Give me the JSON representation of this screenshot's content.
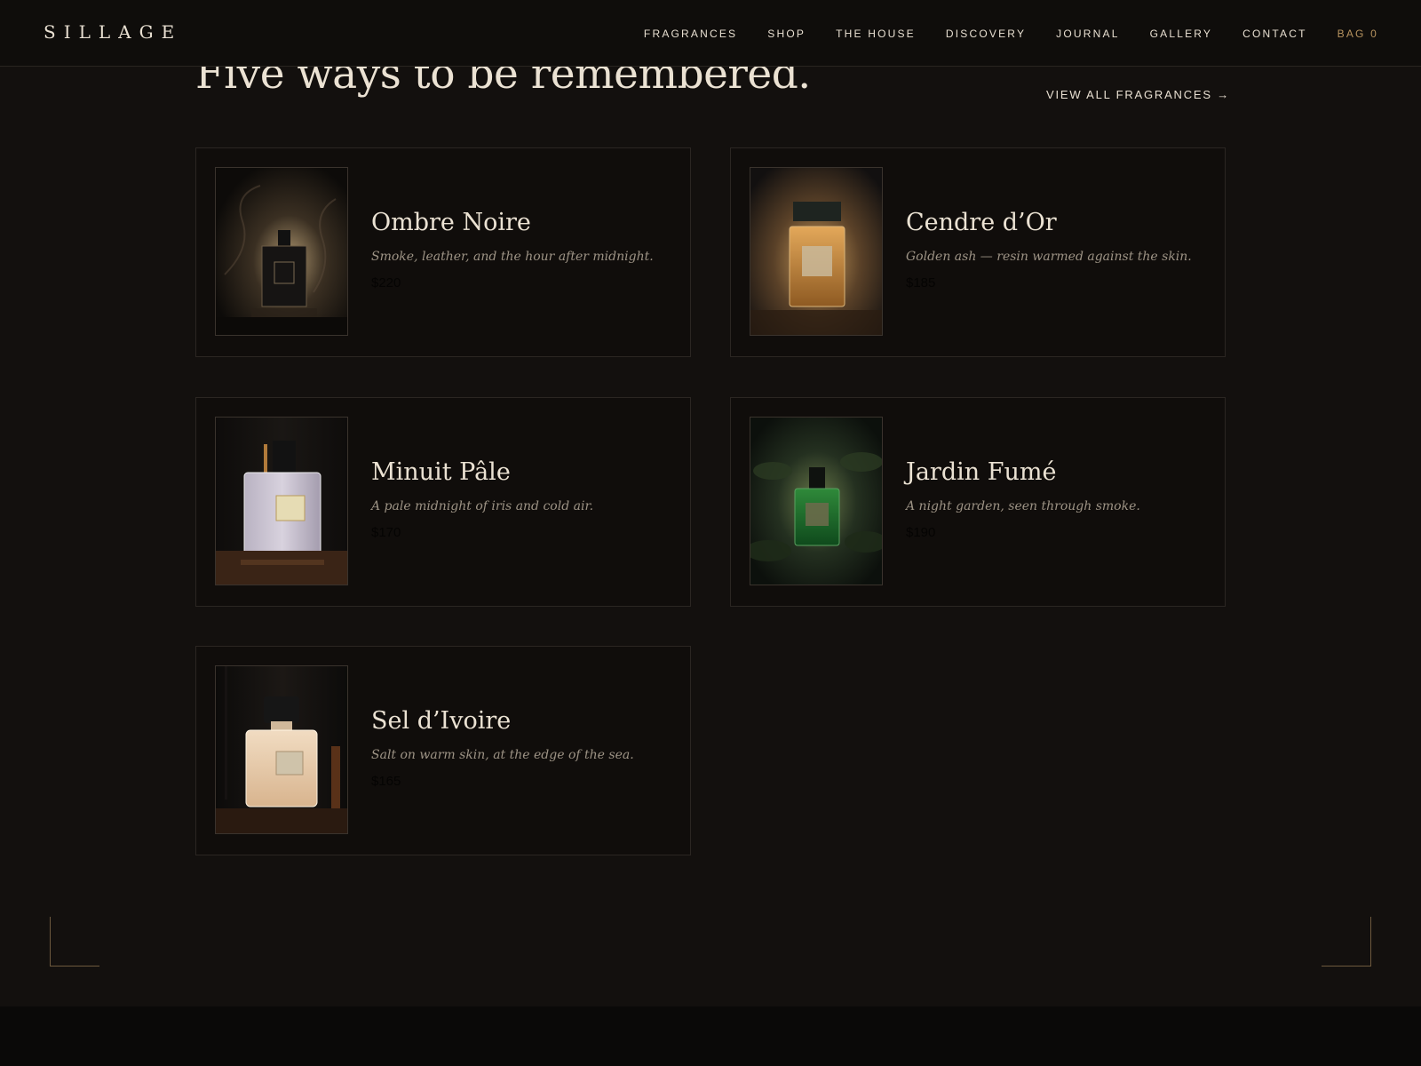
{
  "header": {
    "logo": "SILLAGE",
    "nav": [
      {
        "label": "FRAGRANCES"
      },
      {
        "label": "SHOP"
      },
      {
        "label": "THE HOUSE"
      },
      {
        "label": "DISCOVERY"
      },
      {
        "label": "JOURNAL"
      },
      {
        "label": "GALLERY"
      },
      {
        "label": "CONTACT"
      },
      {
        "label": "BAG 0"
      }
    ]
  },
  "section": {
    "title": "Five ways to be remembered.",
    "view_all": "VIEW ALL FRAGRANCES →"
  },
  "products": [
    {
      "name": "Ombre Noire",
      "description": "Smoke, leather, and the hour after midnight.",
      "price": "$220"
    },
    {
      "name": "Cendre d’Or",
      "description": "Golden ash — resin warmed against the skin.",
      "price": "$185"
    },
    {
      "name": "Minuit Pâle",
      "description": "A pale midnight of iris and cold air.",
      "price": "$170"
    },
    {
      "name": "Jardin Fumé",
      "description": "A night garden, seen through smoke.",
      "price": "$190"
    },
    {
      "name": "Sel d’Ivoire",
      "description": "Salt on warm skin, at the edge of the sea.",
      "price": "$165"
    }
  ],
  "colors": {
    "background": "#13100e",
    "accent": "#b7935f",
    "text": "#e9e0d2"
  }
}
